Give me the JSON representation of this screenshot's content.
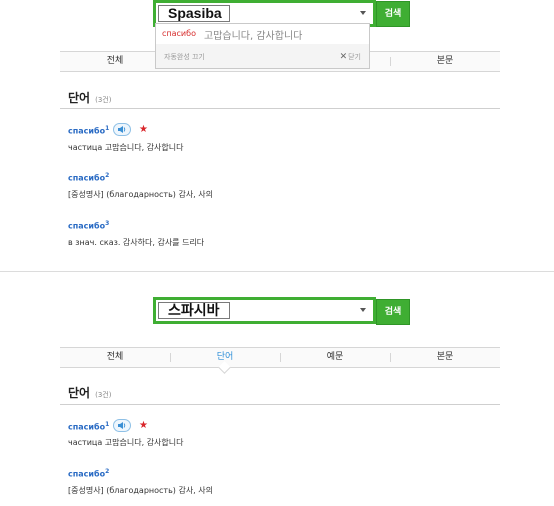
{
  "panel1": {
    "search": {
      "caption": "Spasiba",
      "button": "검색"
    },
    "suggest": {
      "word": "спасибо",
      "meaning": "고맙습니다, 감사합니다",
      "autocomplete_off": "자동완성 끄기",
      "close_label": "닫기"
    },
    "tabs": [
      {
        "label": "전체"
      },
      {
        "label": ""
      },
      {
        "label": ""
      },
      {
        "label": "본문"
      }
    ],
    "section": {
      "title": "단어",
      "count": "(3건)"
    },
    "entries": [
      {
        "word": "спасибо",
        "sup": "1",
        "definition": "частица 고맙습니다, 감사합니다"
      },
      {
        "word": "спасибо",
        "sup": "2",
        "definition": "[중성명사] (благодарность) 감사, 사의"
      },
      {
        "word": "спасибо",
        "sup": "3",
        "definition": "в знач. сказ. 감사하다, 감사를 드리다"
      }
    ]
  },
  "panel2": {
    "search": {
      "caption": "스파시바",
      "button": "검색"
    },
    "tabs": [
      {
        "label": "전체"
      },
      {
        "label": "단어"
      },
      {
        "label": "예문"
      },
      {
        "label": "본문"
      }
    ],
    "section": {
      "title": "단어",
      "count": "(3건)"
    },
    "entries": [
      {
        "word": "спасибо",
        "sup": "1",
        "definition": "частица 고맙습니다, 감사합니다"
      },
      {
        "word": "спасибо",
        "sup": "2",
        "definition": "[중성명사] (благодарность) 감사, 사의"
      }
    ]
  },
  "colors": {
    "accent_green": "#3fae33",
    "link_blue": "#2a6bc4",
    "active_tab": "#2f8fd8",
    "star_red": "#d9262b"
  },
  "icons": {
    "speaker": "speaker-icon",
    "star": "star-icon",
    "dropdown": "chevron-down-icon",
    "close": "close-icon"
  }
}
